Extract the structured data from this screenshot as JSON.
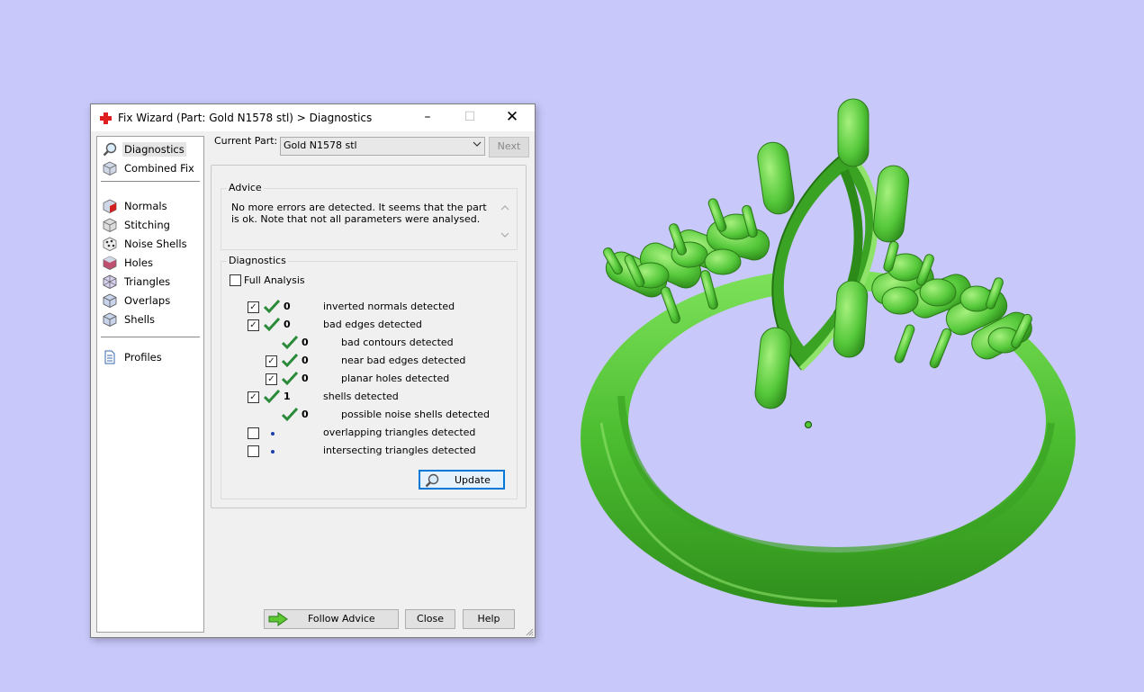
{
  "window": {
    "title": "Fix Wizard (Part: Gold N1578 stl) > Diagnostics",
    "controls": {
      "minimize": "–",
      "maximize": "☐",
      "close": "✕"
    }
  },
  "nav": {
    "items": [
      {
        "label": "Diagnostics",
        "icon": "magnifier-icon"
      },
      {
        "label": "Combined Fix",
        "icon": "cube-icon"
      },
      {
        "label": "Normals",
        "icon": "normals-cube-icon"
      },
      {
        "label": "Stitching",
        "icon": "stitching-cube-icon"
      },
      {
        "label": "Noise Shells",
        "icon": "noise-shells-icon"
      },
      {
        "label": "Holes",
        "icon": "holes-cube-icon"
      },
      {
        "label": "Triangles",
        "icon": "triangles-icon"
      },
      {
        "label": "Overlaps",
        "icon": "overlaps-icon"
      },
      {
        "label": "Shells",
        "icon": "shells-icon"
      },
      {
        "label": "Profiles",
        "icon": "document-icon"
      }
    ],
    "selected": "Diagnostics"
  },
  "current_part": {
    "label": "Current Part:",
    "value": "Gold N1578 stl",
    "next_label": "Next"
  },
  "advice": {
    "title": "Advice",
    "text": "No more errors are detected. It seems that the part is ok. Note that not all parameters were analysed."
  },
  "diagnostics": {
    "title": "Diagnostics",
    "full_analysis_label": "Full Analysis",
    "full_analysis_checked": false,
    "rows": [
      {
        "checkbox": true,
        "checked": true,
        "status": "ok",
        "count": "0",
        "label": "inverted normals detected",
        "indent": 0
      },
      {
        "checkbox": true,
        "checked": true,
        "status": "ok",
        "count": "0",
        "label": "bad edges detected",
        "indent": 0
      },
      {
        "checkbox": false,
        "checked": false,
        "status": "ok",
        "count": "0",
        "label": "bad contours detected",
        "indent": 1
      },
      {
        "checkbox": true,
        "checked": true,
        "status": "ok",
        "count": "0",
        "label": "near bad edges detected",
        "indent": 1
      },
      {
        "checkbox": true,
        "checked": true,
        "status": "ok",
        "count": "0",
        "label": "planar holes detected",
        "indent": 1
      },
      {
        "checkbox": true,
        "checked": true,
        "status": "ok",
        "count": "1",
        "label": "shells detected",
        "indent": 0
      },
      {
        "checkbox": false,
        "checked": false,
        "status": "ok",
        "count": "0",
        "label": "possible noise shells detected",
        "indent": 1
      },
      {
        "checkbox": true,
        "checked": false,
        "status": "pending",
        "count": "",
        "label": "overlapping triangles detected",
        "indent": 0
      },
      {
        "checkbox": true,
        "checked": false,
        "status": "pending",
        "count": "",
        "label": "intersecting triangles detected",
        "indent": 0
      }
    ],
    "update_label": "Update"
  },
  "buttons": {
    "follow_advice": "Follow Advice",
    "close": "Close",
    "help": "Help"
  },
  "colors": {
    "background": "#c8c8fa",
    "model_green": "#55c83a",
    "check_green": "#2a8a3a",
    "accent_blue": "#0078d7"
  }
}
